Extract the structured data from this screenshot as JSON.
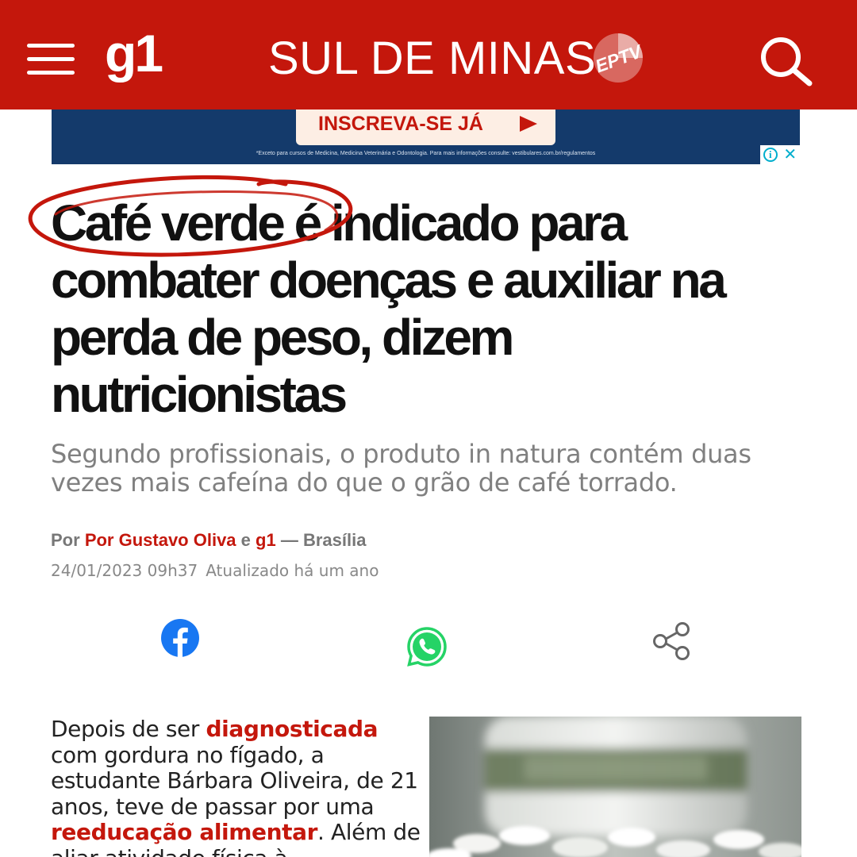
{
  "header": {
    "logo": "g1",
    "region": "SUL DE MINAS",
    "affiliate_logo": "EPTV",
    "menu_icon": "hamburger-menu-icon",
    "search_icon": "search-icon",
    "brand_color": "#c4170c"
  },
  "ad": {
    "cta_label": "INSCREVA-SE JÁ",
    "disclaimer": "*Exceto para cursos de Medicina, Medicina Veterinária e Odontologia. Para mais informações consulte: vestibulares.com.br/regulamentos",
    "info_glyph": "i",
    "close_glyph": "✕",
    "background_color": "#143a6b"
  },
  "article": {
    "headline": {
      "highlight": "Café verde",
      "rest": " é indicado para combater doenças e auxiliar na perda de peso, dizem nutricionistas"
    },
    "subtitle": "Segundo profissionais, o produto in natura contém duas vezes mais cafeína do que o grão de café torrado.",
    "byline": {
      "prefix": "Por",
      "author": "Por Gustavo Oliva",
      "conjunction": "e",
      "outlet": "g1",
      "location": "— Brasília"
    },
    "published": "24/01/2023 09h37",
    "updated": "Atualizado há um ano",
    "share": {
      "facebook_icon": "facebook-icon",
      "whatsapp_icon": "whatsapp-icon",
      "share_icon": "share-icon"
    },
    "body": {
      "t1": "Depois de ser ",
      "link1": "diagnosticada",
      "t2": " com gordura no fígado, a estudante Bárbara Oliveira, de 21 anos, teve de passar por uma ",
      "link2": "reeducação alimentar",
      "t3": ". Além de aliar atividade física à"
    }
  }
}
